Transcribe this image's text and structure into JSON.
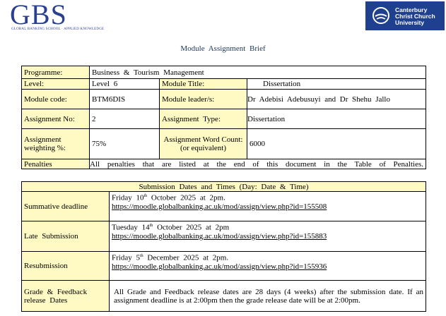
{
  "logos": {
    "gbs": {
      "letters": "GBS",
      "tagline": "GLOBAL BANKING SCHOOL · APPLIED KNOWLEDGE"
    },
    "canterbury": {
      "line1": "Canterbury",
      "line2": "Christ Church",
      "line3": "University",
      "icon": "canterbury-cross-circle-icon"
    }
  },
  "document_title": "Module Assignment Brief",
  "module_table": {
    "programme_label": "Programme:",
    "programme_value": "Business & Tourism Management",
    "level_label": "Level:",
    "level_value": "Level 6",
    "module_title_label": "Module Title:",
    "module_title_value": "Dissertation",
    "module_code_label": "Module code:",
    "module_code_value": "BTM6DIS",
    "module_leader_label": "Module leader/s:",
    "module_leader_value": "Dr Adebisi Adebusuyi and Dr Shehu Jallo",
    "assignment_no_label": "Assignment No:",
    "assignment_no_value": "2",
    "assignment_type_label": "Assignment Type:",
    "assignment_type_value": "Dissertation",
    "weighting_label": "Assignment weighting %:",
    "weighting_value": "75%",
    "word_count_label": "Assignment Word Count: (or equivalent)",
    "word_count_value": "6000",
    "penalties_label": "Penalties",
    "penalties_value": "All penalties that are listed at the end of this document in the Table of Penalties."
  },
  "submission_table": {
    "header": "Submission Dates and Times (Day: Date & Time)",
    "rows": [
      {
        "label": "Summative deadline",
        "day": "Friday",
        "date_num": "10",
        "date_sup": "th",
        "date_rest": "October 2025 at 2pm.",
        "link": "https://moodle.globalbanking.ac.uk/mod/assign/view.php?id=155508"
      },
      {
        "label": "Late Submission",
        "day": "Tuesday",
        "date_num": "14",
        "date_sup": "th",
        "date_rest": "October 2025 at 2pm",
        "link": "https://moodle.globalbanking.ac.uk/mod/assign/view.php?id=155883"
      },
      {
        "label": "Resubmission",
        "day": "Friday",
        "date_num": "5",
        "date_sup": "th",
        "date_rest": "December 2025 at 2pm.",
        "link": "https://moodle.globalbanking.ac.uk/mod/assign/view.php?id=155936"
      }
    ],
    "feedback_label": "Grade & Feedback release Dates",
    "feedback_text": "All Grade and Feedback release dates are 28 days (4 weeks) after the submission date. If an assignment deadline is at 2:00pm then the grade release date will be at 2:00pm."
  }
}
